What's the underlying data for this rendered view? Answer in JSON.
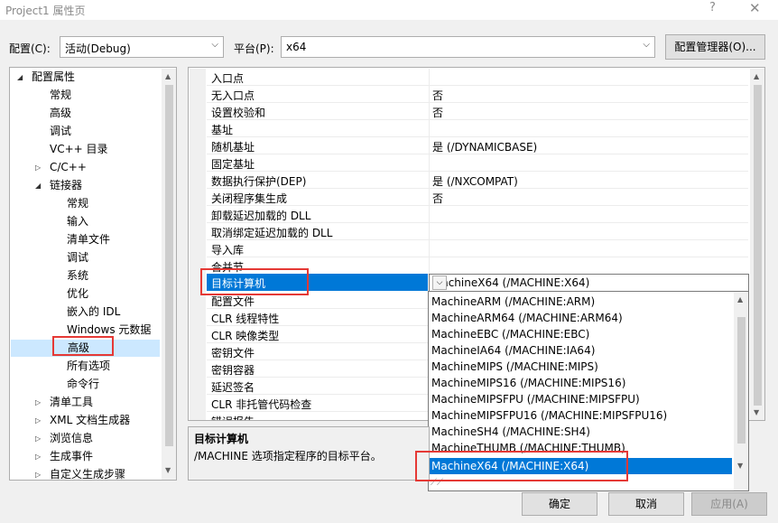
{
  "window": {
    "title": "Project1 属性页",
    "help_glyph": "?",
    "close_glyph": "✕"
  },
  "config_row": {
    "config_label": "配置(C):",
    "config_value": "活动(Debug)",
    "platform_label": "平台(P):",
    "platform_value": "x64",
    "manager_button": "配置管理器(O)..."
  },
  "tree": {
    "items": [
      {
        "label": "配置属性",
        "expander": "◢"
      },
      {
        "label": "常规"
      },
      {
        "label": "高级"
      },
      {
        "label": "调试"
      },
      {
        "label": "VC++ 目录"
      },
      {
        "label": "C/C++",
        "expander": "▷"
      },
      {
        "label": "链接器",
        "expander": "◢"
      },
      {
        "label": "常规"
      },
      {
        "label": "输入"
      },
      {
        "label": "清单文件"
      },
      {
        "label": "调试"
      },
      {
        "label": "系统"
      },
      {
        "label": "优化"
      },
      {
        "label": "嵌入的 IDL"
      },
      {
        "label": "Windows 元数据"
      },
      {
        "label": "高级",
        "selected": true
      },
      {
        "label": "所有选项"
      },
      {
        "label": "命令行"
      },
      {
        "label": "清单工具",
        "expander": "▷"
      },
      {
        "label": "XML 文档生成器",
        "expander": "▷"
      },
      {
        "label": "浏览信息",
        "expander": "▷"
      },
      {
        "label": "生成事件",
        "expander": "▷"
      },
      {
        "label": "自定义生成步骤",
        "expander": "▷"
      }
    ]
  },
  "grid": {
    "rows_top": [
      {
        "name": "入口点",
        "value": ""
      },
      {
        "name": "无入口点",
        "value": "否"
      },
      {
        "name": "设置校验和",
        "value": "否"
      },
      {
        "name": "基址",
        "value": ""
      },
      {
        "name": "随机基址",
        "value": "是 (/DYNAMICBASE)"
      },
      {
        "name": "固定基址",
        "value": ""
      },
      {
        "name": "数据执行保护(DEP)",
        "value": "是 (/NXCOMPAT)"
      },
      {
        "name": "关闭程序集生成",
        "value": "否"
      },
      {
        "name": "卸载延迟加载的 DLL",
        "value": ""
      },
      {
        "name": "取消绑定延迟加载的 DLL",
        "value": ""
      },
      {
        "name": "导入库",
        "value": ""
      },
      {
        "name": "合并节",
        "value": ""
      }
    ],
    "selected_row": {
      "name": "目标计算机",
      "value": "MachineX64 (/MACHINE:X64)"
    },
    "rows_bottom": [
      {
        "name": "配置文件"
      },
      {
        "name": "CLR 线程特性"
      },
      {
        "name": "CLR 映像类型"
      },
      {
        "name": "密钥文件"
      },
      {
        "name": "密钥容器"
      },
      {
        "name": "延迟签名"
      },
      {
        "name": "CLR 非托管代码检查"
      },
      {
        "name": "错误报告"
      }
    ]
  },
  "dropdown": {
    "options": [
      "MachineARM (/MACHINE:ARM)",
      "MachineARM64 (/MACHINE:ARM64)",
      "MachineEBC (/MACHINE:EBC)",
      "MachineIA64 (/MACHINE:IA64)",
      "MachineMIPS (/MACHINE:MIPS)",
      "MachineMIPS16 (/MACHINE:MIPS16)",
      "MachineMIPSFPU (/MACHINE:MIPSFPU)",
      "MachineMIPSFPU16 (/MACHINE:MIPSFPU16)",
      "MachineSH4 (/MACHINE:SH4)",
      "MachineTHUMB (/MACHINE:THUMB)",
      "MachineX64 (/MACHINE:X64)"
    ],
    "selected": "MachineX64 (/MACHINE:X64)"
  },
  "description": {
    "title": "目标计算机",
    "text": "/MACHINE 选项指定程序的目标平台。"
  },
  "buttons": {
    "ok": "确定",
    "cancel": "取消",
    "apply": "应用(A)"
  },
  "colors": {
    "selection": "#0078d7",
    "tree_selection": "#cce8ff",
    "highlight_box": "#e53935"
  }
}
